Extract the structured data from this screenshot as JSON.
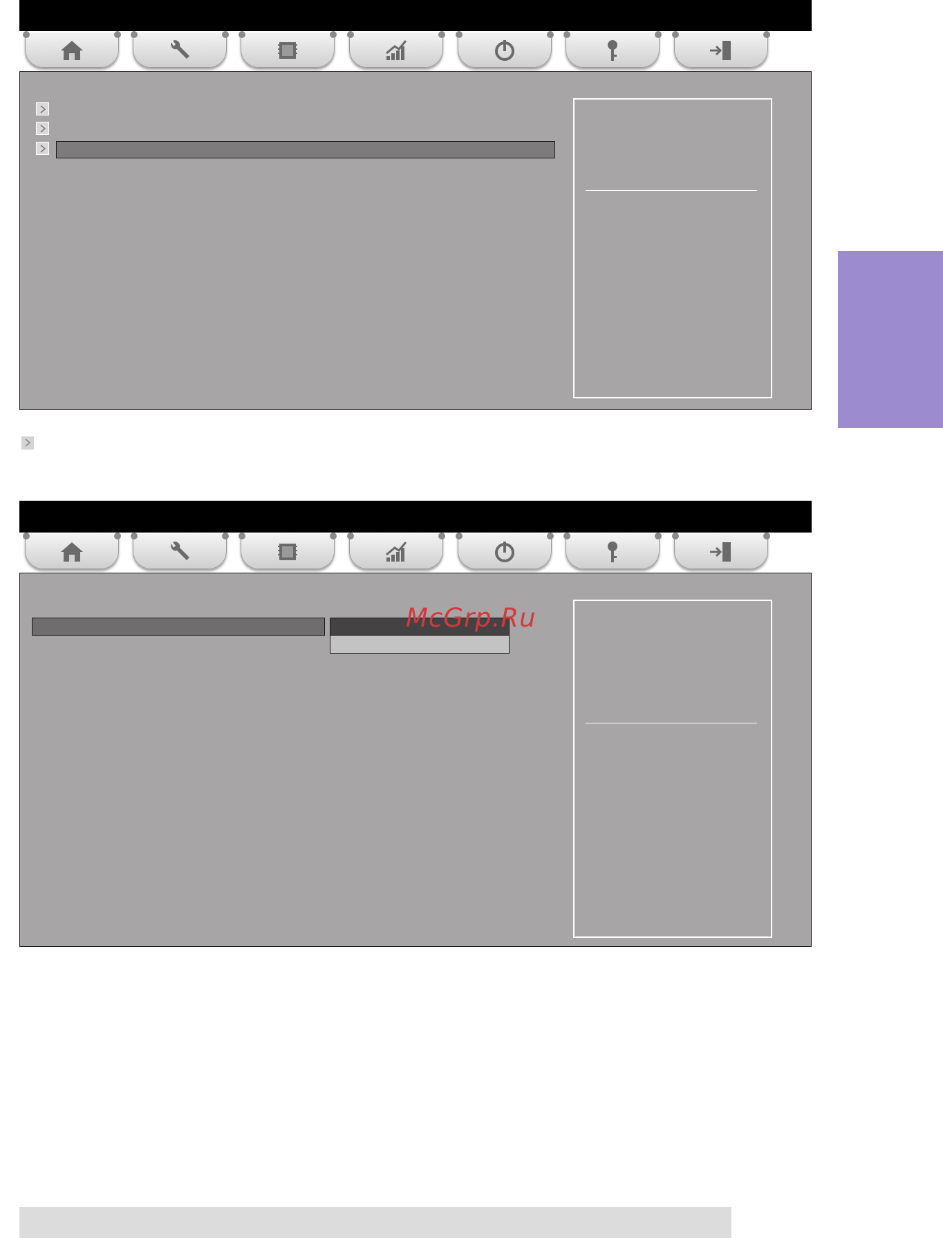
{
  "watermark": "McGrp.Ru",
  "colors": {
    "title_bar": "#000000",
    "panel_bg": "#a7a5a6",
    "selected_bar": "#7d7b7c",
    "dropdown_active": "#444243",
    "dropdown_item": "#c4c3c3",
    "watermark": "#d23a3e",
    "side_tab": "#9c8ccf",
    "footer_bar": "#dcdcdc"
  },
  "tabs": [
    {
      "icon": "home-icon"
    },
    {
      "icon": "wrench-icon"
    },
    {
      "icon": "cpu-chip-icon"
    },
    {
      "icon": "performance-chart-icon"
    },
    {
      "icon": "power-icon"
    },
    {
      "icon": "security-key-icon"
    },
    {
      "icon": "exit-door-icon"
    }
  ],
  "screens": [
    {
      "menu_items": 3,
      "selected_index": 2
    },
    {
      "dropdown_options": 2,
      "selected_option": 0
    }
  ]
}
